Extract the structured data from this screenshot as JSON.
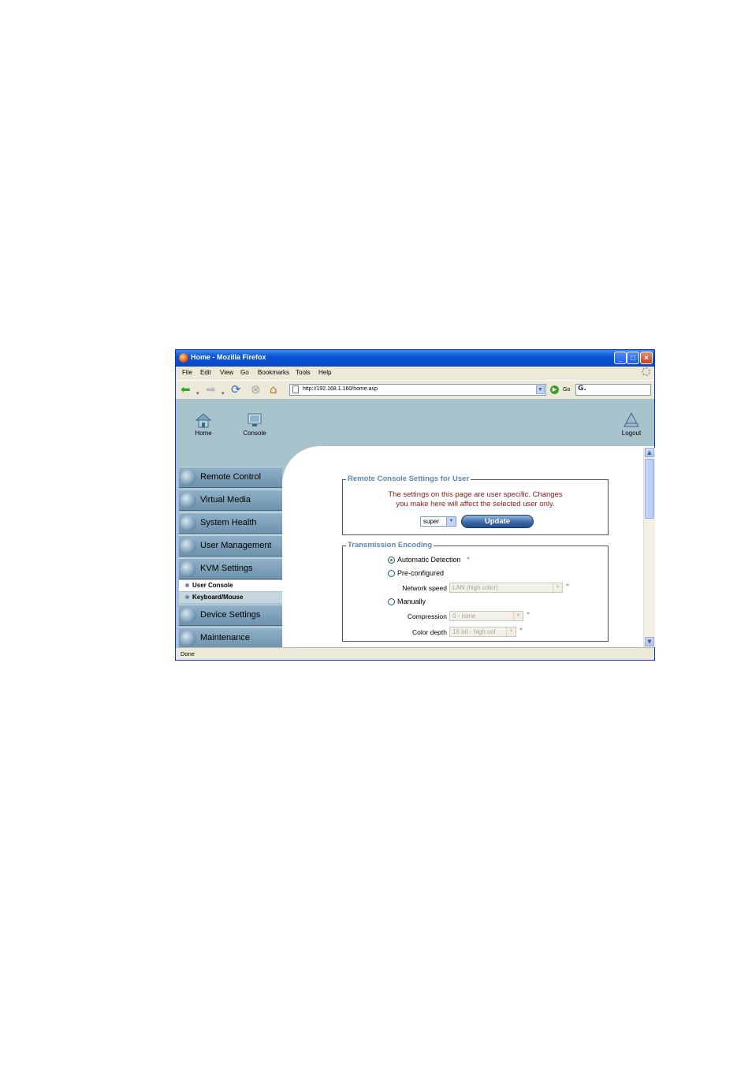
{
  "window": {
    "title": "Home - Mozilla Firefox"
  },
  "menu": [
    "File",
    "Edit",
    "View",
    "Go",
    "Bookmarks",
    "Tools",
    "Help"
  ],
  "navbar": {
    "url": "http://192.168.1.160/home.asp",
    "go_label": "Go"
  },
  "header": {
    "home_label": "Home",
    "console_label": "Console",
    "logout_label": "Logout"
  },
  "sidebar": {
    "items": [
      {
        "label": "Remote Control"
      },
      {
        "label": "Virtual Media"
      },
      {
        "label": "System Health"
      },
      {
        "label": "User Management"
      },
      {
        "label": "KVM Settings"
      },
      {
        "label": "Device Settings"
      },
      {
        "label": "Maintenance"
      }
    ],
    "subitems": [
      {
        "label": "User Console"
      },
      {
        "label": "Keyboard/Mouse"
      }
    ]
  },
  "remote_console": {
    "legend": "Remote Console Settings for User",
    "note_line1": "The settings on this page are user specific. Changes",
    "note_line2": "you make here will affect the selected user only.",
    "user_value": "super",
    "update_label": "Update"
  },
  "transmission": {
    "legend": "Transmission Encoding",
    "auto_label": "Automatic Detection",
    "preconf_label": "Pre-configured",
    "network_speed_label": "Network speed",
    "network_speed_value": "LAN (high color)",
    "manual_label": "Manually",
    "compression_label": "Compression",
    "compression_value": "0 - none",
    "color_depth_label": "Color depth",
    "color_depth_value": "16 bit - high col",
    "star": "*"
  },
  "status": {
    "text": "Done"
  }
}
